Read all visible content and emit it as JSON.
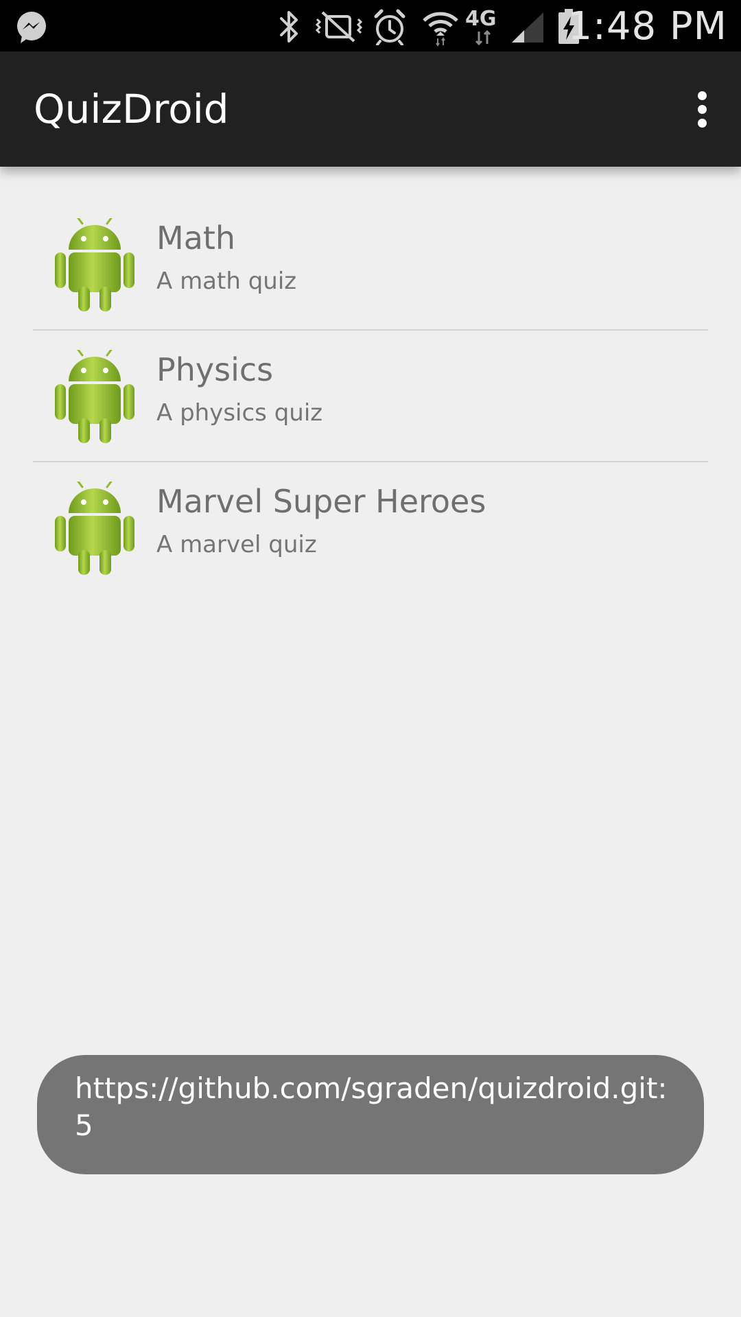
{
  "status_bar": {
    "time": "1:48 PM",
    "network_label": "4G",
    "icons": [
      "messenger-icon",
      "bluetooth-icon",
      "vibrate-icon",
      "alarm-icon",
      "wifi-icon",
      "lte-icon",
      "cell-signal-icon",
      "battery-charging-icon"
    ]
  },
  "app": {
    "title": "QuizDroid",
    "menu_icon": "overflow-menu-icon",
    "colors": {
      "action_bar": "#212121",
      "android_green": "#9bc23c",
      "toast": "#757575"
    }
  },
  "quizzes": [
    {
      "title": "Math",
      "description": "A math quiz",
      "icon": "android-robot-icon"
    },
    {
      "title": "Physics",
      "description": "A physics quiz",
      "icon": "android-robot-icon"
    },
    {
      "title": "Marvel Super Heroes",
      "description": "A marvel quiz",
      "icon": "android-robot-icon"
    }
  ],
  "toast": {
    "message": "https://github.com/sgraden/quizdroid.git:5"
  }
}
